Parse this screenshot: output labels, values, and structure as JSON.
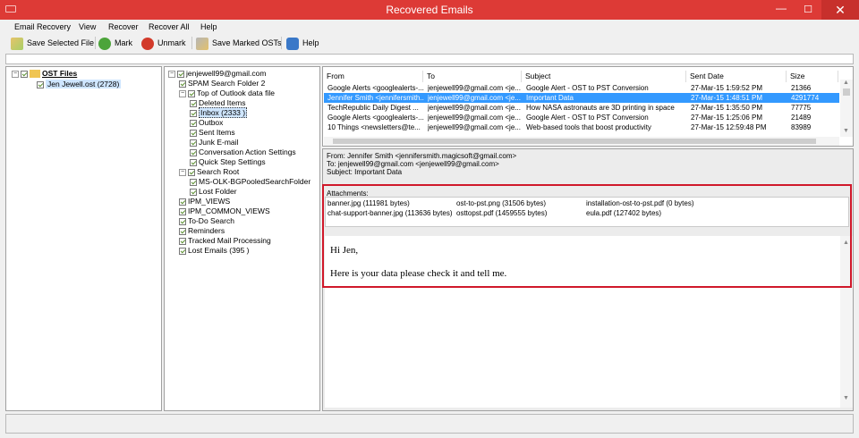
{
  "window": {
    "title": "Recovered Emails",
    "min_icon": "minimize-icon",
    "max_icon": "maximize-icon",
    "close_icon": "close-icon",
    "close_glyph": "✕",
    "max_glyph": "☐",
    "min_glyph": "—"
  },
  "menu": {
    "items": [
      "Email Recovery",
      "View",
      "Recover",
      "Recover All",
      "Help"
    ]
  },
  "toolbar": {
    "save_selected": "Save Selected File",
    "mark": "Mark",
    "unmark": "Unmark",
    "save_marked": "Save Marked OSTs",
    "help": "Help"
  },
  "file_tree": {
    "root": "OST Files",
    "file": "Jen Jewell.ost (2728)"
  },
  "folder_tree": [
    {
      "label": "jenjewell99@gmail.com",
      "level": 0,
      "exp": "−"
    },
    {
      "label": "SPAM Search Folder 2",
      "level": 1
    },
    {
      "label": "Top of Outlook data file",
      "level": 1,
      "exp": "−"
    },
    {
      "label": "Deleted Items",
      "level": 2
    },
    {
      "label": "Inbox  (2333 )",
      "level": 2,
      "selected": true
    },
    {
      "label": "Outbox",
      "level": 2
    },
    {
      "label": "Sent Items",
      "level": 2
    },
    {
      "label": "Junk E-mail",
      "level": 2
    },
    {
      "label": "Conversation Action Settings",
      "level": 2
    },
    {
      "label": "Quick Step Settings",
      "level": 2
    },
    {
      "label": "Search Root",
      "level": 1,
      "exp": "−"
    },
    {
      "label": "MS-OLK-BGPooledSearchFolder",
      "level": 2
    },
    {
      "label": "Lost Folder",
      "level": 2
    },
    {
      "label": "IPM_VIEWS",
      "level": 1
    },
    {
      "label": "IPM_COMMON_VIEWS",
      "level": 1
    },
    {
      "label": "To-Do Search",
      "level": 1
    },
    {
      "label": "Reminders",
      "level": 1
    },
    {
      "label": "Tracked Mail Processing",
      "level": 1
    },
    {
      "label": "Lost Emails  (395 )",
      "level": 1
    }
  ],
  "email_list": {
    "columns": [
      "From",
      "To",
      "Subject",
      "Sent Date",
      "Size"
    ],
    "rows": [
      {
        "from": "Google Alerts <googlealerts-...",
        "to": "jenjewell99@gmail.com <je...",
        "subject": "Google Alert - OST to PST Conversion",
        "date": "27-Mar-15 1:59:52 PM",
        "size": "21366"
      },
      {
        "from": "Jennifer Smith <jennifersmith...",
        "to": "jenjewell99@gmail.com <je...",
        "subject": "Important Data",
        "date": "27-Mar-15 1:48:51 PM",
        "size": "4291774",
        "selected": true
      },
      {
        "from": "TechRepublic Daily Digest ...",
        "to": "jenjewell99@gmail.com <je...",
        "subject": "How NASA astronauts are 3D printing in space",
        "date": "27-Mar-15 1:35:50 PM",
        "size": "77775"
      },
      {
        "from": "Google Alerts <googlealerts-...",
        "to": "jenjewell99@gmail.com <je...",
        "subject": "Google Alert - OST to PST Conversion",
        "date": "27-Mar-15 1:25:06 PM",
        "size": "21489"
      },
      {
        "from": "10 Things <newsletters@te...",
        "to": "jenjewell99@gmail.com <je...",
        "subject": "Web-based tools that boost productivity",
        "date": "27-Mar-15 12:59:48 PM",
        "size": "83989"
      }
    ]
  },
  "preview": {
    "from": "From: Jennifer Smith <jennifersmith.magicsoft@gmail.com>",
    "to": "To: jenjewell99@gmail.com <jenjewell99@gmail.com>",
    "subject": "Subject: Important Data",
    "attachments_label": "Attachments:",
    "attachments": [
      "banner.jpg (111981 bytes)",
      "ost-to-pst.png (31506 bytes)",
      "installation-ost-to-pst.pdf (0 bytes)",
      "chat-support-banner.jpg (113636 bytes)",
      "osttopst.pdf (1459555 bytes)",
      "eula.pdf (127402 bytes)"
    ],
    "greeting": "Hi Jen,",
    "body": "Here is your data please check it and tell me."
  },
  "colors": {
    "titlebar": "#dd3a36",
    "selection": "#3399ff",
    "highlight": "#d0182a"
  }
}
